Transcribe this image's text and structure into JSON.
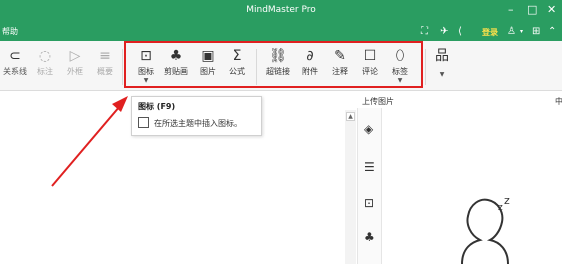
{
  "window": {
    "title": "MindMaster Pro"
  },
  "menu": {
    "help": "帮助",
    "login": "登录"
  },
  "ribbon": {
    "left_tools": [
      {
        "label": "关系线",
        "icon": "relation-line-icon"
      },
      {
        "label": "标注",
        "icon": "callout-icon"
      },
      {
        "label": "外框",
        "icon": "boundary-icon"
      },
      {
        "label": "概要",
        "icon": "summary-icon"
      }
    ],
    "insert_tools": [
      {
        "label": "图标",
        "icon": "icon-insert-icon"
      },
      {
        "label": "剪贴画",
        "icon": "clipart-icon"
      },
      {
        "label": "图片",
        "icon": "picture-icon"
      },
      {
        "label": "公式",
        "icon": "formula-sigma-icon"
      },
      {
        "label": "超链接",
        "icon": "hyperlink-icon"
      },
      {
        "label": "附件",
        "icon": "attachment-icon"
      },
      {
        "label": "注释",
        "icon": "note-pen-icon"
      },
      {
        "label": "评论",
        "icon": "comment-icon"
      },
      {
        "label": "标签",
        "icon": "tag-icon"
      }
    ]
  },
  "tooltip": {
    "title": "图标 (F9)",
    "description": "在所选主题中插入图标。"
  },
  "side_panel": {
    "title": "上传图片",
    "cut_text": "中"
  },
  "colors": {
    "brand_green": "#2a9d61",
    "highlight_red": "#e02020"
  }
}
